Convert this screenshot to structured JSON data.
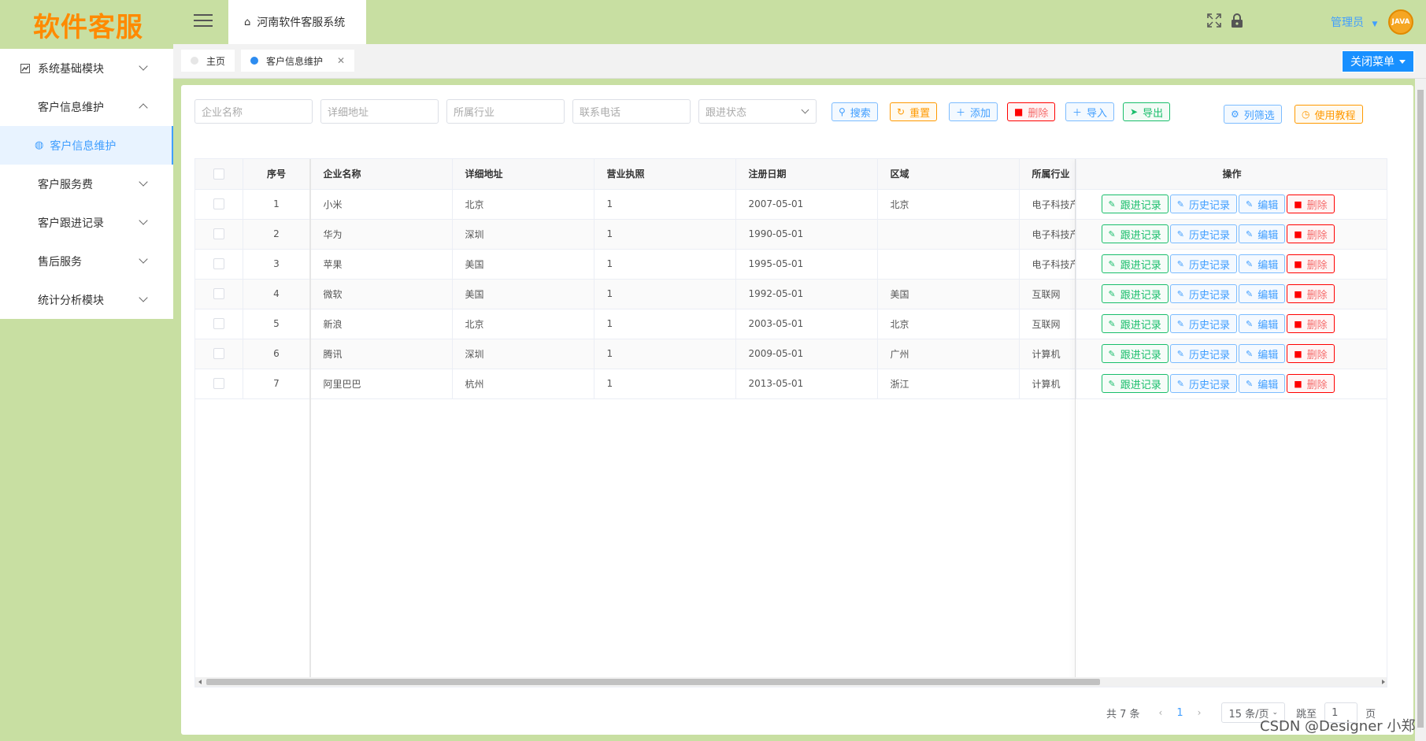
{
  "logo": "软件客服",
  "header": {
    "tab_title": "河南软件客服系统",
    "admin_label": "管理员",
    "avatar_text": "JAVA"
  },
  "sidebar": {
    "items": [
      {
        "label": "系统基础模块",
        "icon": "chart-icon"
      },
      {
        "label": "客户信息维护",
        "icon": "grid-icon",
        "expanded": true
      },
      {
        "label": "客户服务费",
        "icon": "grid-icon"
      },
      {
        "label": "客户跟进记录",
        "icon": "grid-icon"
      },
      {
        "label": "售后服务",
        "icon": "grid-icon"
      },
      {
        "label": "统计分析模块",
        "icon": "grid-icon"
      }
    ],
    "sub_item": "客户信息维护"
  },
  "tabs": {
    "home": "主页",
    "active": "客户信息维护",
    "close_menu": "关闭菜单"
  },
  "filters": {
    "company": "企业名称",
    "address": "详细地址",
    "industry": "所属行业",
    "phone": "联系电话",
    "status": "跟进状态"
  },
  "toolbar": {
    "search": "搜索",
    "reset": "重置",
    "add": "添加",
    "delete": "删除",
    "import": "导入",
    "export": "导出",
    "column_filter": "列筛选",
    "tutorial": "使用教程"
  },
  "table": {
    "headers": [
      "序号",
      "企业名称",
      "详细地址",
      "营业执照",
      "注册日期",
      "区域",
      "所属行业",
      "操作"
    ],
    "rows": [
      [
        "1",
        "小米",
        "北京",
        "1",
        "2007-05-01",
        "北京",
        "电子科技产"
      ],
      [
        "2",
        "华为",
        "深圳",
        "1",
        "1990-05-01",
        "",
        "电子科技产"
      ],
      [
        "3",
        "苹果",
        "美国",
        "1",
        "1995-05-01",
        "",
        "电子科技产"
      ],
      [
        "4",
        "微软",
        "美国",
        "1",
        "1992-05-01",
        "美国",
        "互联网"
      ],
      [
        "5",
        "新浪",
        "北京",
        "1",
        "2003-05-01",
        "北京",
        "互联网"
      ],
      [
        "6",
        "腾讯",
        "深圳",
        "1",
        "2009-05-01",
        "广州",
        "计算机"
      ],
      [
        "7",
        "阿里巴巴",
        "杭州",
        "1",
        "2013-05-01",
        "浙江",
        "计算机"
      ]
    ],
    "row_actions": {
      "follow": "跟进记录",
      "history": "历史记录",
      "edit": "编辑",
      "delete": "删除"
    }
  },
  "pager": {
    "total": "共 7 条",
    "current": "1",
    "page_size": "15 条/页",
    "goto": "跳至",
    "goto_value": "1",
    "page_unit": "页"
  },
  "watermark": "CSDN @Designer 小郑",
  "colors": {
    "theme_bg": "#c8dfa2",
    "logo": "#ff8a00",
    "primary": "#1890ff",
    "success": "#19be6b",
    "warning": "#ff9900",
    "danger": "#f56c6c"
  }
}
